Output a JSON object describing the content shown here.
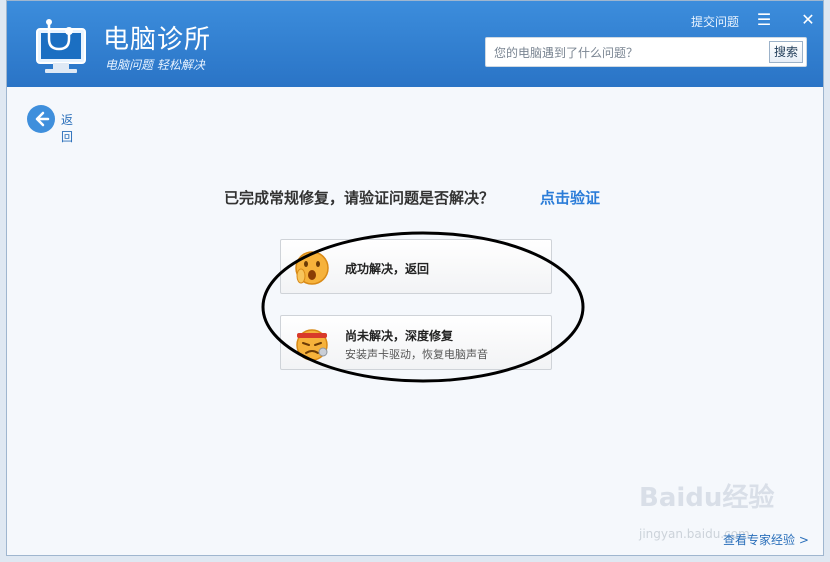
{
  "app": {
    "name": "电脑诊所",
    "slogan": "电脑问题 轻松解决"
  },
  "titlebar": {
    "feedback_link": "提交问题",
    "menu_icon": "menu-icon",
    "close_icon": "close-icon"
  },
  "search": {
    "placeholder": "您的电脑遇到了什么问题？",
    "value": "",
    "button_label": "搜索"
  },
  "back": {
    "label": "返回",
    "icon": "arrow-left-icon"
  },
  "main": {
    "headline": "已完成常规修复，请验证问题是否解决？",
    "verify_link": "点击验证",
    "actions": [
      {
        "title": "成功解决，返回",
        "icon": "happy-face-icon"
      },
      {
        "title": "尚未解决，深度修复",
        "subtitle": "安装声卡驱动，恢复电脑声音",
        "icon": "angry-face-icon"
      }
    ]
  },
  "footer": {
    "expert_link": "查看专家经验 >"
  },
  "watermark": {
    "text": "Baidu经验",
    "url": "jingyan.baidu.com"
  },
  "colors": {
    "accent": "#2a74c6",
    "link": "#2a7cd8"
  }
}
